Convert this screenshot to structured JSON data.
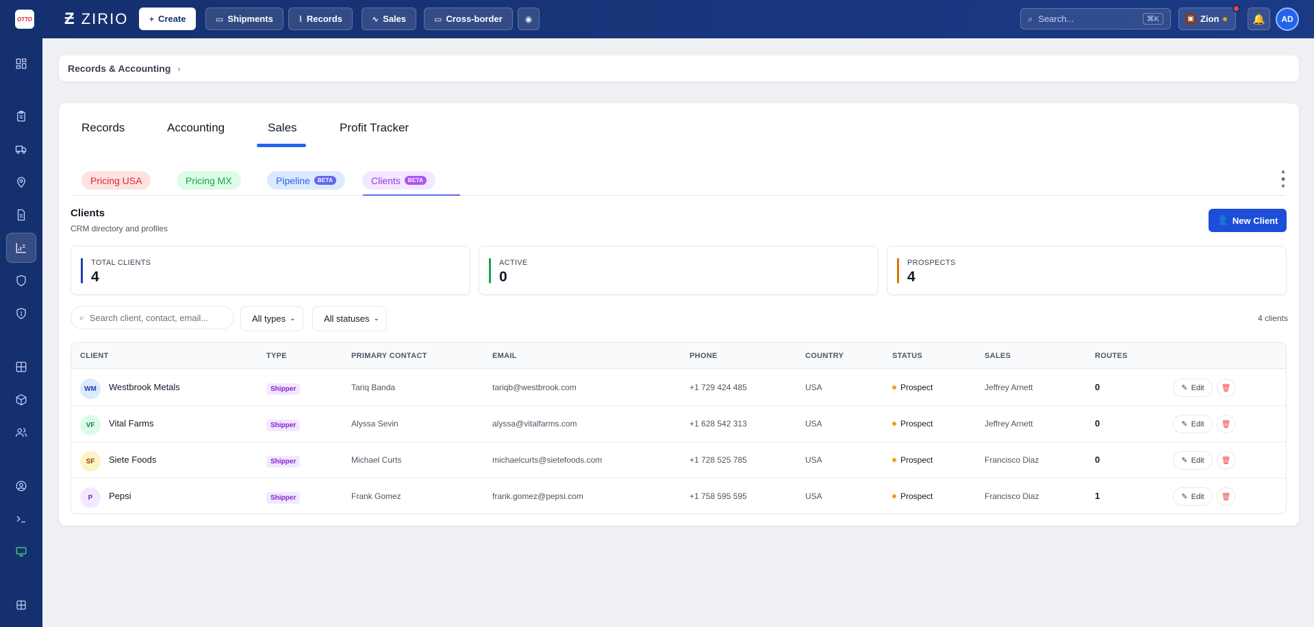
{
  "topbar": {
    "otto_logo": "OTTO",
    "brand": "ZIRIO",
    "nav": [
      {
        "label": "Create",
        "icon": "plus-icon"
      },
      {
        "label": "Shipments",
        "icon": "box-icon"
      },
      {
        "label": "Records",
        "icon": "chart-icon"
      },
      {
        "label": "Sales",
        "icon": "activity-icon"
      },
      {
        "label": "Cross-border",
        "icon": "briefcase-icon"
      }
    ],
    "search_placeholder": "Search...",
    "search_shortcut": "⌘K",
    "org_name": "Zion",
    "user_initials": "AD"
  },
  "breadcrumb": {
    "label": "Records & Accounting",
    "separator": "›"
  },
  "tabs": [
    "Records",
    "Accounting",
    "Sales",
    "Profit Tracker"
  ],
  "active_tab": "Sales",
  "subtabs": [
    {
      "label": "Pricing USA"
    },
    {
      "label": "Pricing MX"
    },
    {
      "label": "Pipeline",
      "badge": "BETA"
    },
    {
      "label": "Clients",
      "badge": "BETA"
    }
  ],
  "section": {
    "title": "Clients",
    "subtitle": "CRM directory and profiles",
    "new_button": "New Client"
  },
  "stats": [
    {
      "label": "TOTAL CLIENTS",
      "value": "4",
      "color": "#1e40af"
    },
    {
      "label": "ACTIVE",
      "value": "0",
      "color": "#16a34a"
    },
    {
      "label": "PROSPECTS",
      "value": "4",
      "color": "#d97706"
    }
  ],
  "filters": {
    "search_placeholder": "Search client, contact, email...",
    "type_select": "All types",
    "status_select": "All statuses",
    "count_label": "4 clients"
  },
  "table": {
    "headers": [
      "CLIENT",
      "TYPE",
      "PRIMARY CONTACT",
      "EMAIL",
      "PHONE",
      "COUNTRY",
      "STATUS",
      "SALES",
      "ROUTES"
    ],
    "rows": [
      {
        "initials": "WM",
        "client": "Westbrook Metals",
        "type": "Shipper",
        "contact": "Tariq Banda",
        "email": "tariqb@westbrook.com",
        "phone": "+1 729 424 485",
        "country": "USA",
        "status": "Prospect",
        "sales": "Jeffrey Arnett",
        "routes": "0",
        "edit": "Edit"
      },
      {
        "initials": "VF",
        "client": "Vital Farms",
        "type": "Shipper",
        "contact": "Alyssa Sevin",
        "email": "alyssa@vitalfarms.com",
        "phone": "+1 628 542 313",
        "country": "USA",
        "status": "Prospect",
        "sales": "Jeffrey Arnett",
        "routes": "0",
        "edit": "Edit"
      },
      {
        "initials": "SF",
        "client": "Siete Foods",
        "type": "Shipper",
        "contact": "Michael Curts",
        "email": "michaelcurts@sietefoods.com",
        "phone": "+1 728 525 785",
        "country": "USA",
        "status": "Prospect",
        "sales": "Francisco Diaz",
        "routes": "0",
        "edit": "Edit"
      },
      {
        "initials": "P",
        "client": "Pepsi",
        "type": "Shipper",
        "contact": "Frank Gomez",
        "email": "frank.gomez@pepsi.com",
        "phone": "+1 758 595 595",
        "country": "USA",
        "status": "Prospect",
        "sales": "Francisco Diaz",
        "routes": "1",
        "edit": "Edit"
      }
    ]
  }
}
